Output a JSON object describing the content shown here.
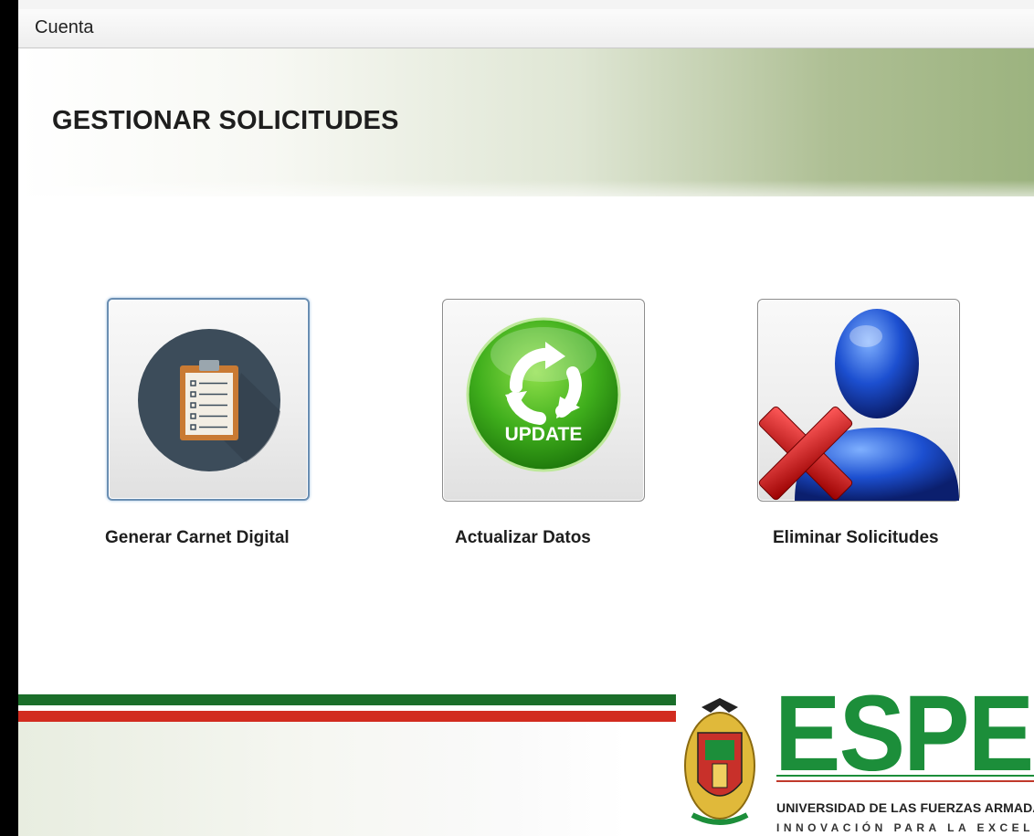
{
  "menubar": {
    "items": [
      {
        "label": "Cuenta"
      }
    ]
  },
  "header": {
    "title": "GESTIONAR SOLICITUDES"
  },
  "actions": [
    {
      "label": "Generar Carnet Digital",
      "icon": "clipboard-icon"
    },
    {
      "label": "Actualizar Datos",
      "icon": "update-icon",
      "icon_text": "UPDATE"
    },
    {
      "label": "Eliminar Solicitudes",
      "icon": "delete-user-icon"
    }
  ],
  "footer": {
    "logo_text": "ESPE",
    "university": "UNIVERSIDAD DE LAS FUERZAS ARMADAS",
    "tagline": "INNOVACIÓN PARA LA EXCELENCIA"
  },
  "colors": {
    "header_green": "#9cb37f",
    "stripe_green": "#1b6e2a",
    "stripe_red": "#d22b1f",
    "espe_green": "#1c8e3a",
    "selected_border": "#6a8eb2"
  }
}
